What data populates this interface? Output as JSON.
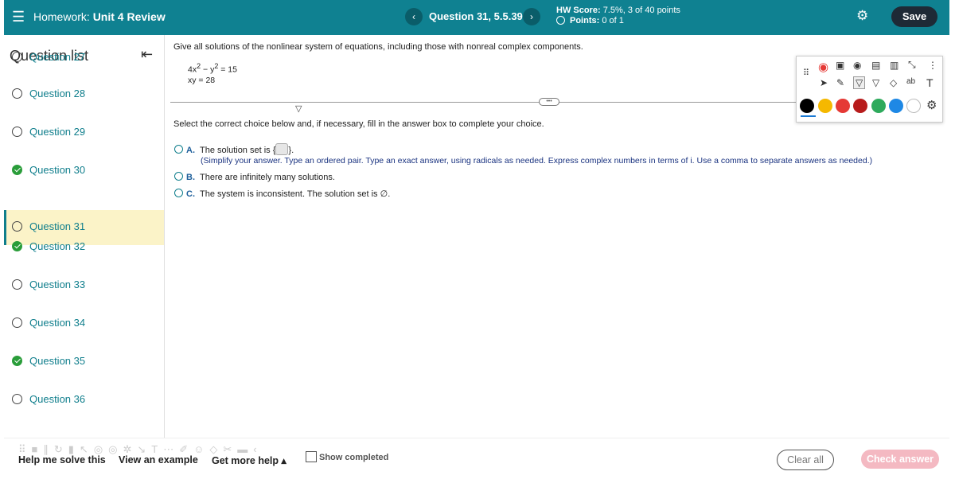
{
  "header": {
    "menu_icon": "☰",
    "hw_prefix": "Homework:",
    "hw_name": "Unit 4 Review",
    "prev_icon": "‹",
    "next_icon": "›",
    "question_title": "Question 31, 5.5.39",
    "hw_score_label": "HW Score:",
    "hw_score_value": "7.5%, 3 of 40 points",
    "points_label": "Points:",
    "points_value": "0 of 1",
    "settings_icon": "⚙",
    "save_label": "Save"
  },
  "sidebar": {
    "title": "Question list",
    "collapse_icon": "⇤",
    "items": [
      {
        "label": "Question 27",
        "status": "open"
      },
      {
        "label": "Question 28",
        "status": "open"
      },
      {
        "label": "Question 29",
        "status": "open"
      },
      {
        "label": "Question 30",
        "status": "done"
      },
      {
        "label": "Question 31",
        "status": "open"
      },
      {
        "label": "Question 32",
        "status": "done"
      },
      {
        "label": "Question 33",
        "status": "open"
      },
      {
        "label": "Question 34",
        "status": "open"
      },
      {
        "label": "Question 35",
        "status": "done"
      },
      {
        "label": "Question 36",
        "status": "open"
      }
    ]
  },
  "question": {
    "prompt": "Give all solutions of the nonlinear system of equations, including those with nonreal complex components.",
    "eq1_a": "4x",
    "eq1_exp1": "2",
    "eq1_mid": " − y",
    "eq1_exp2": "2",
    "eq1_rhs": " = 15",
    "eq2": "xy = 28",
    "instruction": "Select the correct choice below and, if necessary, fill in the answer box to complete your choice.",
    "choice_a_letter": "A.",
    "choice_a_text": "The solution set is {",
    "choice_a_end": "}.",
    "choice_a_hint": "(Simplify your answer. Type an ordered pair. Type an exact answer, using radicals as needed. Express complex numbers in terms of i. Use a comma to separate answers as needed.)",
    "choice_b_letter": "B.",
    "choice_b_text": "There are infinitely many solutions.",
    "choice_c_letter": "C.",
    "choice_c_text": "The system is inconsistent. The solution set is ∅."
  },
  "drawing_toolbar": {
    "colors": [
      "#000000",
      "#f5b800",
      "#e53935",
      "#b71c1c",
      "#2eaa5c",
      "#1e88e5",
      "#ffffff"
    ]
  },
  "footer": {
    "help_me_solve": "Help me solve this",
    "view_example": "View an example",
    "more_help": "Get more help ▴",
    "show_completed": "Show completed",
    "clear_all": "Clear all",
    "check_answer": "Check answer"
  }
}
